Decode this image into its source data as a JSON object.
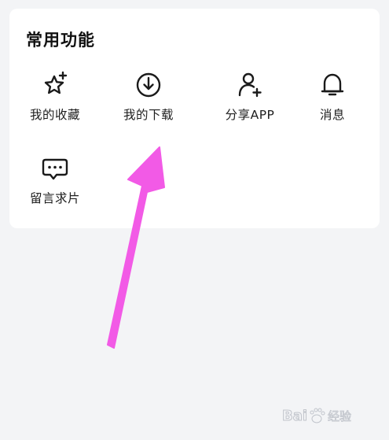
{
  "section": {
    "title": "常用功能"
  },
  "items": [
    {
      "label": "我的收藏",
      "icon": "star-plus-icon"
    },
    {
      "label": "我的下载",
      "icon": "download-icon"
    },
    {
      "label": "分享APP",
      "icon": "add-user-icon"
    },
    {
      "label": "消息",
      "icon": "bell-icon"
    },
    {
      "label": "留言求片",
      "icon": "chat-bubble-icon"
    }
  ],
  "annotation": {
    "arrow_color": "#f25ae6"
  },
  "watermark": {
    "text": "Bai 经验"
  }
}
